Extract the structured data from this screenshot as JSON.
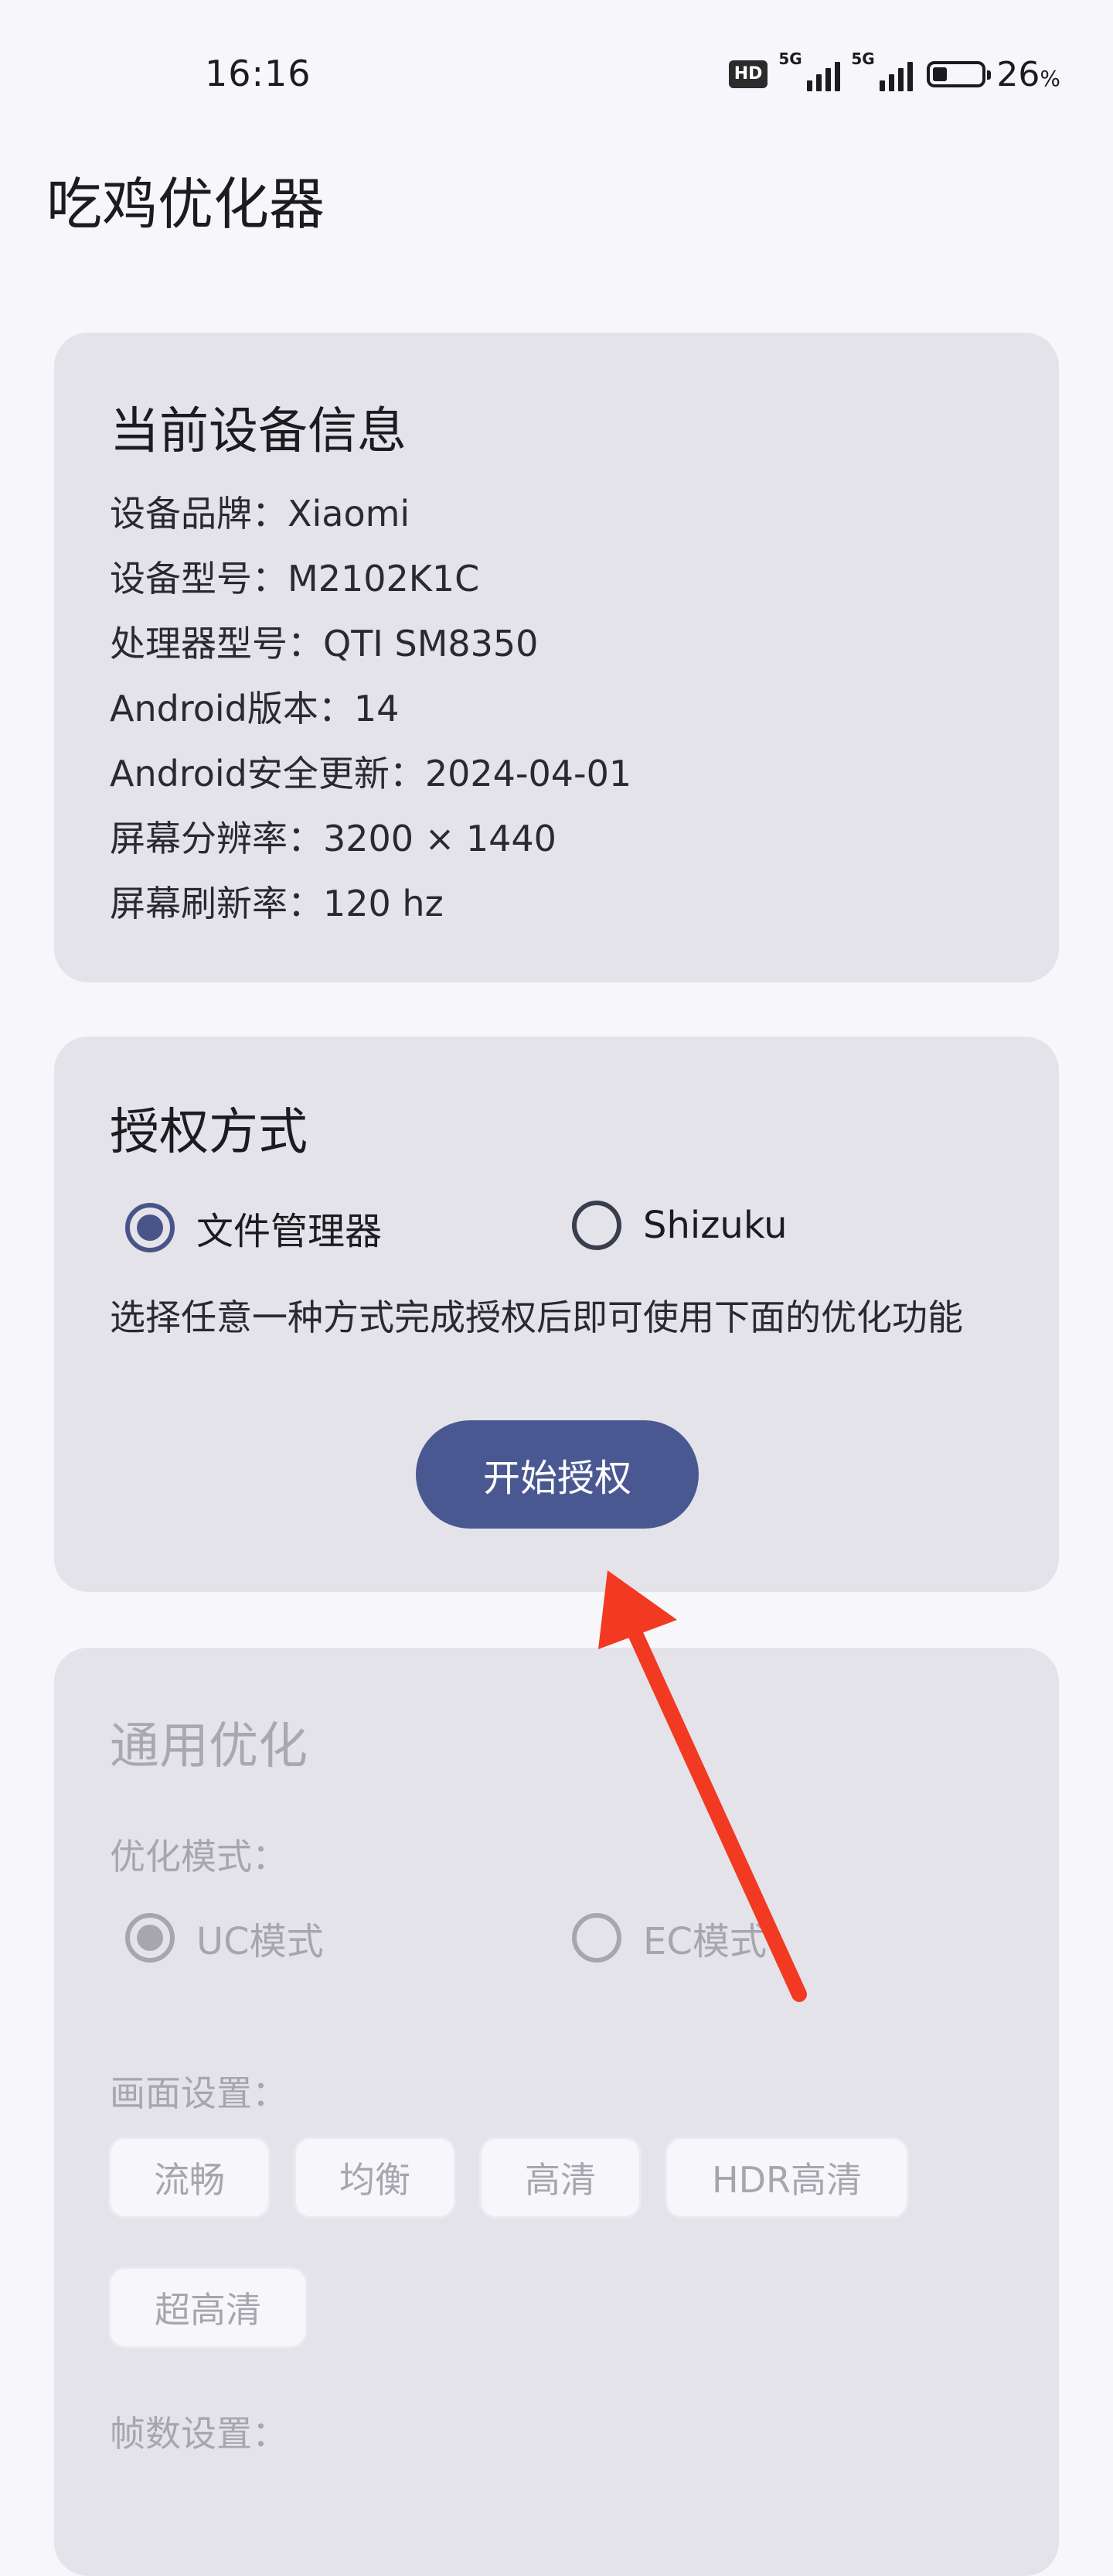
{
  "status_bar": {
    "time": "16:16",
    "hd_badge": "HD",
    "signal1_label": "5G",
    "signal2_label": "5G",
    "battery_percent": "26",
    "battery_unit": "%",
    "battery_level": 0.26
  },
  "app": {
    "title": "吃鸡优化器"
  },
  "device_card": {
    "title": "当前设备信息",
    "rows": [
      "设备品牌：Xiaomi",
      "设备型号：M2102K1C",
      "处理器型号：QTI SM8350",
      "Android版本：14",
      "Android安全更新：2024-04-01",
      "屏幕分辨率：3200 × 1440",
      "屏幕刷新率：120 hz"
    ]
  },
  "auth_card": {
    "title": "授权方式",
    "options": [
      {
        "label": "文件管理器",
        "selected": true
      },
      {
        "label": "Shizuku",
        "selected": false
      }
    ],
    "note": "选择任意一种方式完成授权后即可使用下面的优化功能",
    "button": "开始授权"
  },
  "general_card": {
    "title": "通用优化",
    "mode_label": "优化模式：",
    "mode_options": [
      {
        "label": "UC模式",
        "selected": true
      },
      {
        "label": "EC模式",
        "selected": false
      }
    ],
    "graphics_label": "画面设置：",
    "graphics_options": [
      "流畅",
      "均衡",
      "高清",
      "HDR高清",
      "超高清"
    ],
    "fps_label": "帧数设置："
  },
  "colors": {
    "accent": "#4a5892",
    "card_bg": "#e4e3ea",
    "page_bg": "#f7f6fb",
    "annotation_arrow": "#f23a22",
    "disabled_text": "#a7a6ad"
  }
}
